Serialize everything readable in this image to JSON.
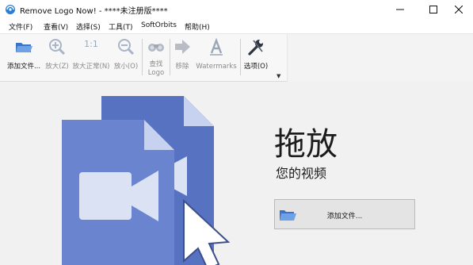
{
  "window": {
    "title": "Remove Logo Now! - ****未注册版****"
  },
  "menu": [
    {
      "label": "文件(F)"
    },
    {
      "label": "查看(V)"
    },
    {
      "label": "选择(S)"
    },
    {
      "label": "工具(T)"
    },
    {
      "label": "SoftOrbits"
    },
    {
      "label": "帮助(H)"
    }
  ],
  "toolbar": {
    "add_file": "添加文件...",
    "zoom_in": "放大(Z)",
    "zoom_normal": "放大正常(N)",
    "zoom_normal_glyph": "1:1",
    "zoom_out": "放小(O)",
    "find_logo": "查找 Logo",
    "remove": "移除",
    "watermarks": "Watermarks",
    "options": "选项(O)"
  },
  "main": {
    "drop_title": "拖放",
    "drop_subtitle": "您的视频",
    "add_file_button": "添加文件..."
  },
  "colors": {
    "doc_back": "#5872c2",
    "doc_front": "#6a84cf",
    "doc_fold": "#c7d2f0",
    "camera": "#dbe2f4"
  }
}
